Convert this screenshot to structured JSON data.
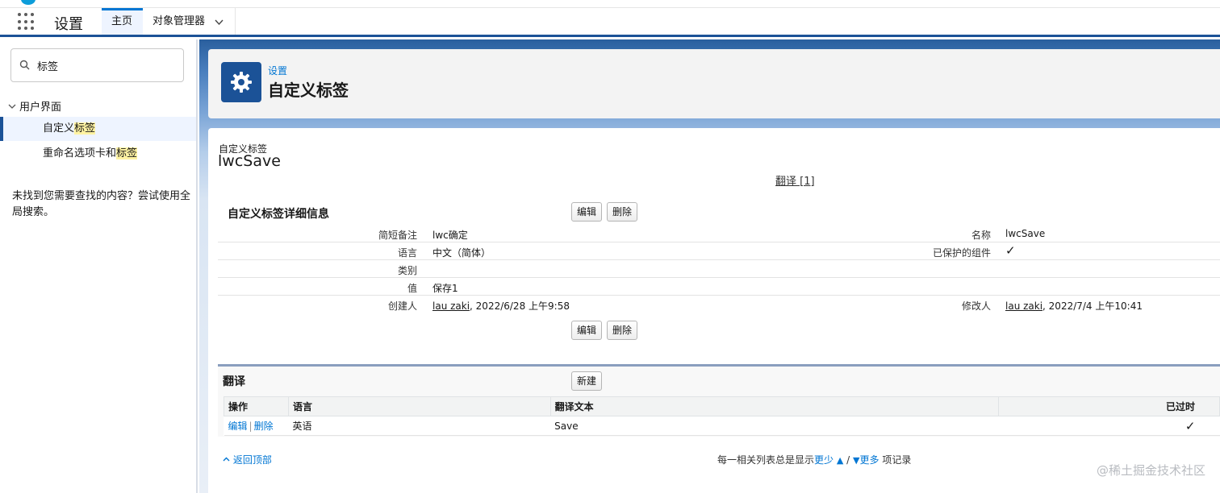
{
  "nav": {
    "app_name": "设置",
    "tabs": [
      {
        "label": "主页"
      },
      {
        "label": "对象管理器"
      }
    ]
  },
  "sidebar": {
    "search_value": "标签",
    "group": "用户界面",
    "items": [
      {
        "label_pre": "自定义",
        "label_hl": "标签"
      },
      {
        "label_pre": "重命名选项卡和",
        "label_hl": "标签"
      }
    ],
    "not_found": "未找到您需要查找的内容？尝试使用全局搜索。"
  },
  "header": {
    "breadcrumb": "设置",
    "title": "自定义标签",
    "icon": "gear-icon"
  },
  "record": {
    "type": "自定义标签",
    "name": "lwcSave",
    "translate_link": "翻译 [1]"
  },
  "detail": {
    "title": "自定义标签详细信息",
    "edit": "编辑",
    "delete": "删除",
    "fields": {
      "short_desc_label": "简短备注",
      "short_desc_value": "lwc确定",
      "name_label": "名称",
      "name_value": "lwcSave",
      "language_label": "语言",
      "language_value": "中文（简体）",
      "protected_label": "已保护的组件",
      "protected_value": "✓",
      "category_label": "类别",
      "category_value": "",
      "value_label": "值",
      "value_value": "保存1",
      "created_label": "创建人",
      "created_user": "lau zaki",
      "created_date": ", 2022/6/28 上午9:58",
      "modified_label": "修改人",
      "modified_user": "lau zaki",
      "modified_date": ", 2022/7/4 上午10:41"
    }
  },
  "translations": {
    "title": "翻译",
    "new": "新建",
    "columns": [
      "操作",
      "语言",
      "翻译文本",
      "已过时"
    ],
    "rows": [
      {
        "edit": "编辑",
        "sep": "|",
        "delete": "删除",
        "language": "英语",
        "text": "Save",
        "outdated": "✓"
      }
    ]
  },
  "footer": {
    "back_to_top": "返回顶部",
    "pager_prefix": "每一相关列表总是显示",
    "fewer": "更少",
    "slash": "/",
    "more": "更多",
    "pager_suffix": "项记录"
  },
  "watermark": "@稀土掘金技术社区"
}
